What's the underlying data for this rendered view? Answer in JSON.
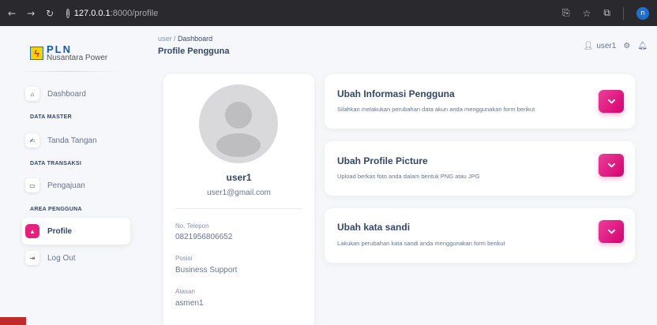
{
  "browser": {
    "url_host": "127.0.0.1",
    "url_path": ":8000/profile",
    "profile_initial": "n"
  },
  "sidebar": {
    "logo_title": "PLN",
    "logo_subtitle": "Nusantara Power",
    "items": [
      {
        "label": "Dashboard",
        "icon": "home-icon"
      },
      {
        "section": "DATA MASTER"
      },
      {
        "label": "Tanda Tangan",
        "icon": "signature-icon"
      },
      {
        "section": "DATA TRANSAKSI"
      },
      {
        "label": "Pengajuan",
        "icon": "document-icon"
      },
      {
        "section": "AREA PENGGUNA"
      },
      {
        "label": "Profile",
        "icon": "user-icon",
        "active": true
      },
      {
        "label": "Log Out",
        "icon": "logout-icon"
      }
    ]
  },
  "header": {
    "breadcrumb_root": "user",
    "breadcrumb_sep": "/",
    "breadcrumb_current": "Dashboard",
    "title": "Profile Pengguna",
    "username": "user1"
  },
  "profile": {
    "name": "user1",
    "email": "user1@gmail.com",
    "phone_label": "No. Telepon",
    "phone": "0821956806652",
    "position_label": "Posisi",
    "position": "Business Support",
    "supervisor_label": "Atasan",
    "supervisor": "asmen1"
  },
  "cards": [
    {
      "title": "Ubah Informasi Pengguna",
      "desc": "Silahkan melakukan perubahan data akun anda menggunakan form berikut"
    },
    {
      "title": "Ubah Profile Picture",
      "desc": "Upload berkas foto anda dalam bentuk PNG atau JPG"
    },
    {
      "title": "Ubah kata sandi",
      "desc": "Lakukan perubahan kata sandi anda menggunakan form berikut"
    }
  ],
  "colors": {
    "accent": "#e91e7d",
    "text": "#344767"
  }
}
